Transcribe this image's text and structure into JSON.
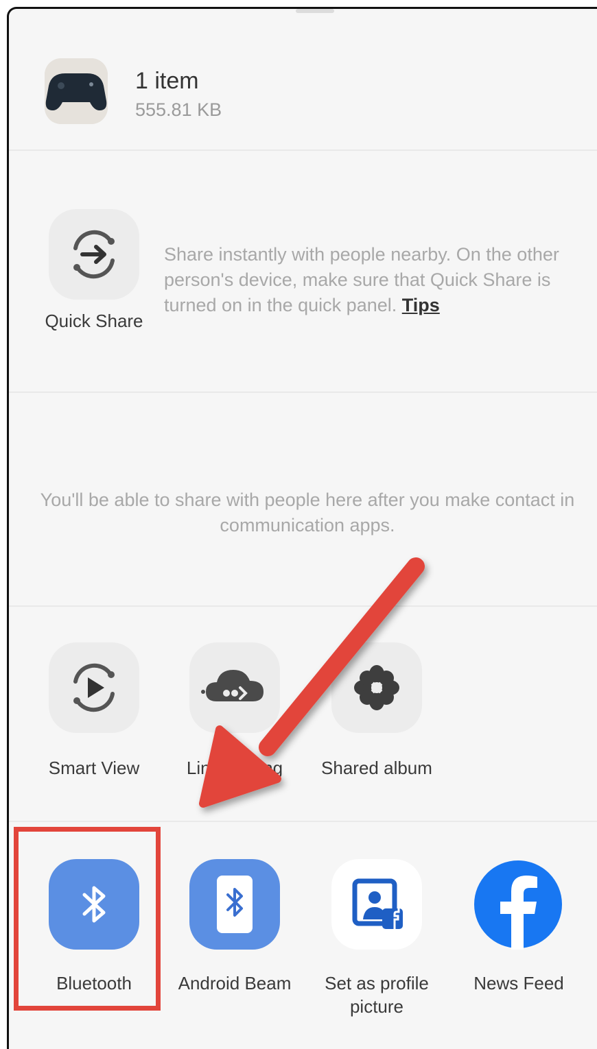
{
  "share_item": {
    "title": "1 item",
    "size": "555.81 KB",
    "thumbnail": "game-controller-image"
  },
  "quick_share": {
    "label": "Quick Share",
    "description": "Share instantly with people nearby. On the other person's device, make sure that Quick Share is turned on in the quick panel.",
    "tips_link": "Tips",
    "icon": "quick-share-icon"
  },
  "contacts": {
    "message": "You'll be able to share with people here after you make contact in communication apps."
  },
  "services": [
    {
      "label": "Smart View",
      "icon": "smart-view-icon"
    },
    {
      "label": "Link sharing",
      "icon": "cloud-link-icon"
    },
    {
      "label": "Shared album",
      "icon": "flower-icon"
    }
  ],
  "apps": [
    {
      "label": "Bluetooth",
      "icon": "bluetooth-icon"
    },
    {
      "label": "Android Beam",
      "icon": "android-beam-icon"
    },
    {
      "label": "Set as profile picture",
      "icon": "facebook-profile-icon"
    },
    {
      "label": "News Feed",
      "icon": "facebook-icon"
    }
  ],
  "colors": {
    "bluetooth_blue": "#5b8fe3",
    "facebook_blue": "#1877f2",
    "annotation_red": "#e2453b"
  }
}
